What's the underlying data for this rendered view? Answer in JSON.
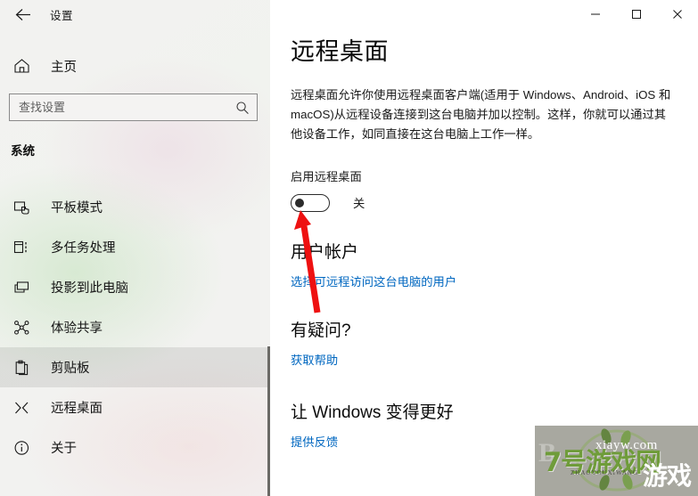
{
  "window": {
    "app_title": "设置",
    "back_icon": "back-arrow-icon",
    "controls": {
      "minimize": "minimize-icon",
      "maximize": "maximize-icon",
      "close": "close-icon"
    }
  },
  "sidebar": {
    "home": {
      "label": "主页",
      "icon": "home-icon"
    },
    "search": {
      "placeholder": "查找设置",
      "icon": "search-icon",
      "value": ""
    },
    "group_title": "系统",
    "items": [
      {
        "label": "平板模式",
        "icon": "tablet-mode-icon",
        "selected": false
      },
      {
        "label": "多任务处理",
        "icon": "multitasking-icon",
        "selected": false
      },
      {
        "label": "投影到此电脑",
        "icon": "projecting-icon",
        "selected": false
      },
      {
        "label": "体验共享",
        "icon": "shared-experiences-icon",
        "selected": false
      },
      {
        "label": "剪贴板",
        "icon": "clipboard-icon",
        "selected": true
      },
      {
        "label": "远程桌面",
        "icon": "remote-desktop-icon",
        "selected": false
      },
      {
        "label": "关于",
        "icon": "info-icon",
        "selected": false
      }
    ]
  },
  "main": {
    "page_title": "远程桌面",
    "description": "远程桌面允许你使用远程桌面客户端(适用于 Windows、Android、iOS 和 macOS)从远程设备连接到这台电脑并加以控制。这样，你就可以通过其他设备工作，如同直接在这台电脑上工作一样。",
    "enable_label": "启用远程桌面",
    "toggle": {
      "state_label": "关",
      "on": false
    },
    "sections": [
      {
        "heading": "用户帐户",
        "link": "选择可远程访问这台电脑的用户"
      },
      {
        "heading": "有疑问?",
        "link": "获取帮助"
      },
      {
        "heading": "让 Windows 变得更好",
        "link": "提供反馈"
      }
    ]
  },
  "annotation": {
    "arrow_color": "#ee1111",
    "arrow_label": "red-pointer-arrow"
  },
  "watermark": {
    "background_text": "B",
    "domain_text": "xiayw.com",
    "main_text": "7号游戏网",
    "subtitle_text": "ZHAOYOUXIWANG",
    "big_text": "游戏",
    "accent_color": "#6f9c3a"
  }
}
